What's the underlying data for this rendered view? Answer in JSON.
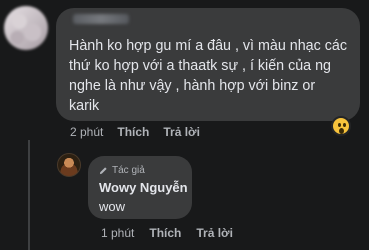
{
  "comment": {
    "text": "Hành ko hợp gu mí a đâu , vì màu nhạc các thứ ko hợp với a thaatk sự , í kiến của ng nghe là như vậy , hành hợp với binz or karik",
    "time": "2 phút",
    "like_label": "Thích",
    "reply_label": "Trả lời",
    "reaction_icon": "wow-reaction-icon"
  },
  "reply": {
    "badge": "Tác giả",
    "author": "Wowy Nguyễn",
    "text": "wow",
    "time": "1 phút",
    "like_label": "Thích",
    "reply_label": "Trả lời"
  },
  "colors": {
    "background": "#18191a",
    "bubble": "#3a3b3c",
    "text": "#e4e6eb",
    "secondary": "#b0b3b8"
  }
}
